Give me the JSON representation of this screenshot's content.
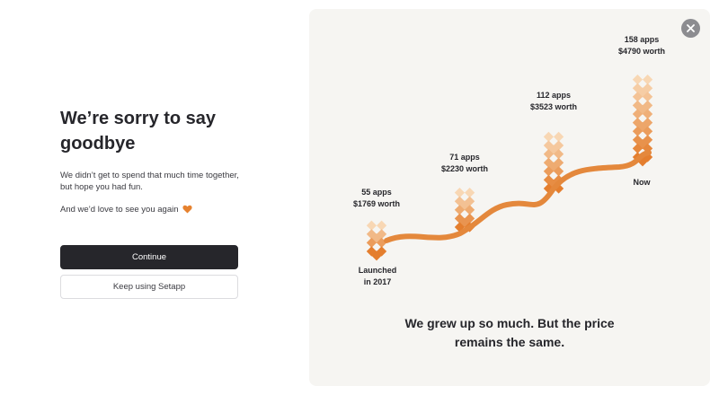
{
  "left": {
    "title": "We’re sorry to say goodbye",
    "description": "We didn’t get to spend that much time together, but hope you had fun.",
    "love_text": "And we’d love to see you again",
    "heart_icon": "heart-icon",
    "continue_label": "Continue",
    "keep_label": "Keep using Setapp"
  },
  "panel": {
    "close_icon": "close-icon",
    "milestones": [
      {
        "line1": "55 apps",
        "line2": "$1769 worth"
      },
      {
        "line1": "71 apps",
        "line2": "$2230 worth"
      },
      {
        "line1": "112 apps",
        "line2": "$3523 worth"
      },
      {
        "line1": "158 apps",
        "line2": "$4790 worth"
      }
    ],
    "start_label_1": "Launched",
    "start_label_2": "in 2017",
    "end_label": "Now",
    "footer_1": "We grew up so much. But the price",
    "footer_2": "remains the same."
  },
  "colors": {
    "accent": "#e4883c",
    "primary_button": "#26262b",
    "panel_bg": "#f6f5f2"
  }
}
